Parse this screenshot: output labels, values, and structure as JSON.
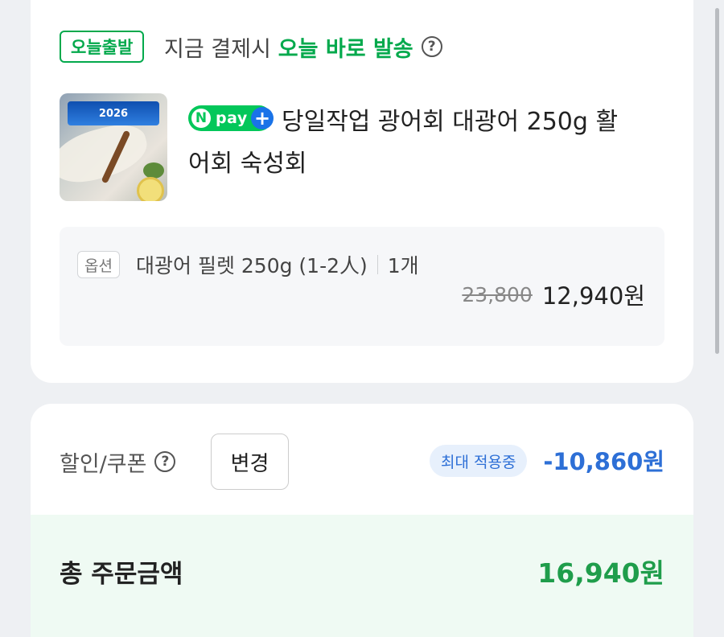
{
  "shipping": {
    "badge": "오늘출발",
    "prefix": "지금 결제시",
    "highlight": "오늘 바로 발송",
    "help": "?"
  },
  "product": {
    "thumb_banner": "2026",
    "npay_letter": "N",
    "npay_text": "pay",
    "npay_plus": "+",
    "title_line1": "당일작업 광어회 대광어 250g 활",
    "title_line2": "어회 숙성회"
  },
  "option": {
    "tag": "옵션",
    "name": "대광어 필렛 250g (1-2人)",
    "quantity": "1개",
    "original_price": "23,800",
    "final_price": "12,940원"
  },
  "discount": {
    "label": "할인/쿠폰",
    "help": "?",
    "change_button": "변경",
    "status_badge": "최대 적용중",
    "amount": "-10,860원"
  },
  "total": {
    "label": "총 주문금액",
    "amount": "16,940원"
  },
  "colors": {
    "green": "#03a94c",
    "npay_green": "#03c75a",
    "blue": "#2d6fd6",
    "total_green": "#1f9d4b"
  }
}
